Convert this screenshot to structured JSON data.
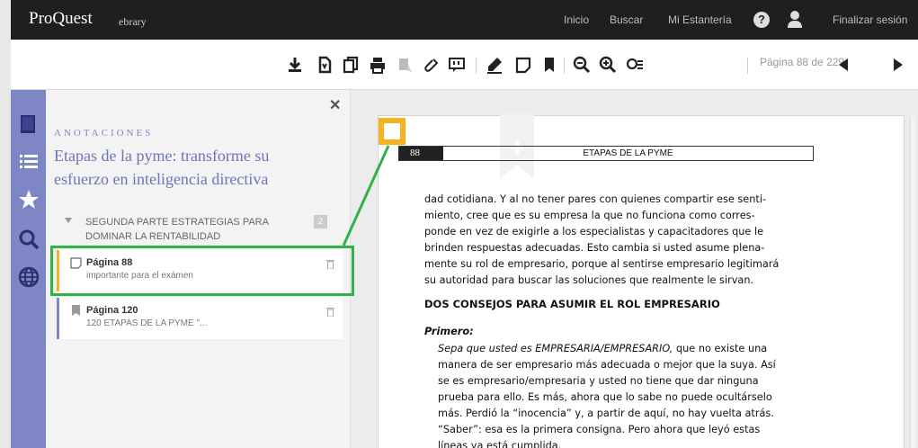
{
  "topbar": {
    "brand": "ProQuest",
    "brand_sub": "ebrary",
    "nav_inicio": "Inicio",
    "nav_buscar": "Buscar",
    "nav_estanteria": "Mi Estantería",
    "help": "?",
    "nav_logout": "Finalizar sesión"
  },
  "toolbar": {
    "page_indicator": "Página 88 de 229"
  },
  "panel": {
    "label": "ANOTACIONES",
    "title_line1": "Etapas de la pyme: transforme su",
    "title_line2": "esfuerzo en inteligencia directiva",
    "section_line1": "SEGUNDA PARTE ESTRATEGIAS PARA",
    "section_line2": "DOMINAR LA RENTABILIDAD",
    "section_count": "2",
    "notes": [
      {
        "title": "Página 88",
        "sub": "importante para el exámen",
        "color": "#f5b321"
      },
      {
        "title": "Página 120",
        "sub": "120 ETAPAS DE LA PYME \"...",
        "color": "#7f86c6"
      }
    ]
  },
  "reader": {
    "page_number": "88",
    "page_header": "ETAPAS DE LA PYME",
    "para1": [
      "dad cotidiana. Y al no tener pares con quienes compartir ese senti-",
      "miento, cree que es su empresa la que no funciona como corres-",
      "ponde en vez de exigirle a los especialistas y capacitadores que le",
      "brinden respuestas adecuadas. Esto cambia si usted asume plena-",
      "mente su rol de empresario, porque al sentirse empresario legitimará",
      "su autoridad para buscar las soluciones que realmente le sirvan."
    ],
    "heading": "DOS CONSEJOS PARA ASUMIR EL ROL EMPRESARIO",
    "primero": "Primero:",
    "para2_italic": "Sepa que usted es EMPRESARIA/EMPRESARIO,",
    "para2_first_rest": " que no existe una",
    "para2": [
      "manera de ser empresario más adecuada o mejor que la suya. Así",
      "se es empresario/empresaria y usted no tiene que dar ninguna",
      "prueba para ello. Es más, ahora que lo sabe no puede ocultárselo",
      "más. Perdió la “inocencia” y, a partir de aquí, no hay vuelta atrás.",
      "“Saber”: esa es la primera consigna. Pero ahora que leyó estas",
      "líneas ya está cumplida."
    ]
  },
  "colors": {
    "accent": "#7f86c6",
    "note_yellow": "#f5b321",
    "highlight_green": "#2fb24a",
    "topbar": "#1f1f1f"
  }
}
